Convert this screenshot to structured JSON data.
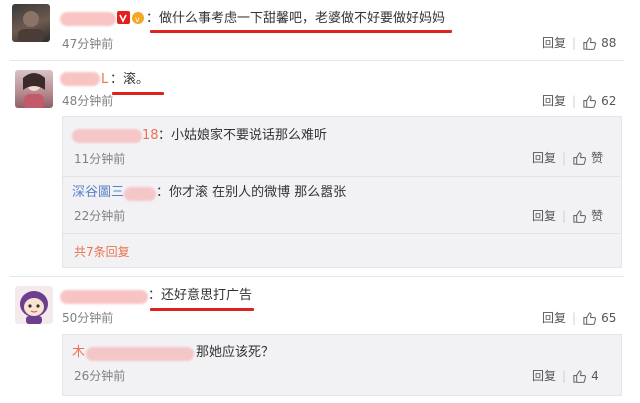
{
  "colors": {
    "accent": "#eb7350",
    "underline": "#e0221e",
    "link_blue": "#5b82c8"
  },
  "comments": [
    {
      "user_visible": "",
      "text": "：做什么事考虑一下甜馨吧，老婆做不好要做好妈妈",
      "time": "47分钟前",
      "reply_label": "回复",
      "like_count": "88"
    },
    {
      "user_visible": "L",
      "text": "：滚。",
      "time": "48分钟前",
      "reply_label": "回复",
      "like_count": "62",
      "replies": [
        {
          "user_visible": "18",
          "text": "：小姑娘家不要说话那么难听",
          "time": "11分钟前",
          "reply_label": "回复",
          "like_label": "赞"
        },
        {
          "user_visible": "深谷圖三",
          "text": "：你才滚 在别人的微博 那么嚣张",
          "time": "22分钟前",
          "reply_label": "回复",
          "like_label": "赞"
        }
      ],
      "more_replies": "共7条回复"
    },
    {
      "user_visible": "",
      "text": "：还好意思打广告",
      "time": "50分钟前",
      "reply_label": "回复",
      "like_count": "65",
      "replies": [
        {
          "user_visible": "木",
          "text": "那她应该死？",
          "time": "26分钟前",
          "reply_label": "回复",
          "like_count": "4"
        }
      ]
    }
  ]
}
